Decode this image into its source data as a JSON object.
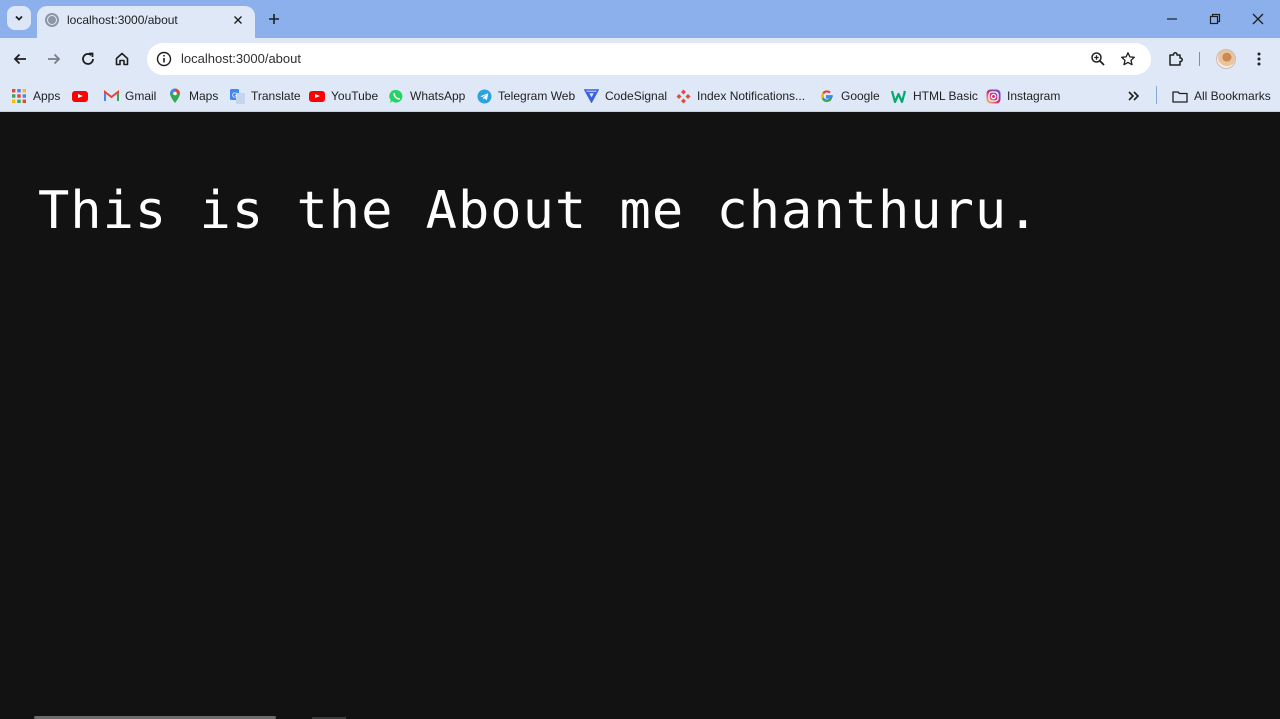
{
  "browser": {
    "tab": {
      "title": "localhost:3000/about"
    },
    "address": {
      "url": "localhost:3000/about"
    },
    "bookmarks": [
      {
        "label": "Apps",
        "icon": "apps-grid-icon"
      },
      {
        "label": "",
        "icon": "youtube-icon"
      },
      {
        "label": "Gmail",
        "icon": "gmail-icon"
      },
      {
        "label": "Maps",
        "icon": "maps-icon"
      },
      {
        "label": "Translate",
        "icon": "translate-icon"
      },
      {
        "label": "YouTube",
        "icon": "youtube-icon"
      },
      {
        "label": "WhatsApp",
        "icon": "whatsapp-icon"
      },
      {
        "label": "Telegram Web",
        "icon": "telegram-icon"
      },
      {
        "label": "CodeSignal",
        "icon": "codesignal-icon"
      },
      {
        "label": "Index Notifications...",
        "icon": "index-icon"
      },
      {
        "label": "Google",
        "icon": "google-icon"
      },
      {
        "label": "HTML Basic",
        "icon": "w3-icon"
      },
      {
        "label": "Instagram",
        "icon": "instagram-icon"
      }
    ],
    "all_bookmarks_label": "All Bookmarks",
    "colors": {
      "tabstrip": "#8bb0ec",
      "toolbar": "#dfe8f7",
      "page_background": "#121212",
      "page_text": "#ffffff"
    }
  },
  "page": {
    "heading": "This is the About me chanthuru."
  }
}
